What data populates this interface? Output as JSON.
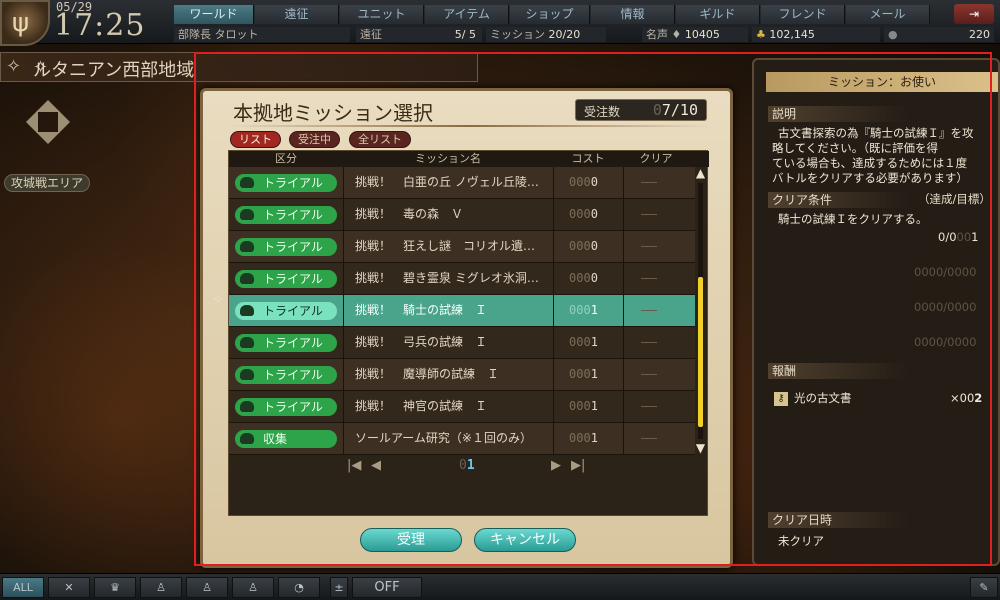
{
  "header": {
    "date": "05/29",
    "time": "17:25",
    "nav": [
      "ワールド",
      "遠征",
      "ユニット",
      "アイテム",
      "ショップ",
      "情報",
      "ギルド",
      "フレンド",
      "メール"
    ],
    "rank": "部隊長 タロット",
    "expedition_label": "遠征",
    "expedition_value": "5/ 5",
    "mission_label": "ミッション",
    "mission_value": "20/20",
    "fame_label": "名声",
    "fame_value": "10405",
    "gold_value": "102,145",
    "crystal_value": "220"
  },
  "region": {
    "title": "ルタニアン西部地域",
    "siege": "攻城戦エリア"
  },
  "panel": {
    "title": "本拠地ミッション選択",
    "count_label": "受注数",
    "count_value": "7/10",
    "filters": [
      "リスト",
      "受注中",
      "全リスト"
    ],
    "columns": [
      "区分",
      "ミッション名",
      "コスト",
      "クリア"
    ],
    "rows": [
      {
        "type": "トライアル",
        "name": "挑戦！　白亜の丘 ノヴェル丘陵…",
        "cost_pad": "000",
        "cost": "0"
      },
      {
        "type": "トライアル",
        "name": "挑戦！　毒の森　Ｖ",
        "cost_pad": "000",
        "cost": "0"
      },
      {
        "type": "トライアル",
        "name": "挑戦！　狂えし謎　コリオル遺…",
        "cost_pad": "000",
        "cost": "0"
      },
      {
        "type": "トライアル",
        "name": "挑戦！　碧き霊泉 ミグレオ氷洞…",
        "cost_pad": "000",
        "cost": "0"
      },
      {
        "type": "トライアル",
        "name": "挑戦！　騎士の試練　Ｉ",
        "cost_pad": "000",
        "cost": "1"
      },
      {
        "type": "トライアル",
        "name": "挑戦！　弓兵の試練　Ｉ",
        "cost_pad": "000",
        "cost": "1"
      },
      {
        "type": "トライアル",
        "name": "挑戦！　魔導師の試練　Ｉ",
        "cost_pad": "000",
        "cost": "1"
      },
      {
        "type": "トライアル",
        "name": "挑戦！　神官の試練　Ｉ",
        "cost_pad": "000",
        "cost": "1"
      },
      {
        "type": "収集",
        "name": "ソールアーム研究（※１回のみ）",
        "cost_pad": "000",
        "cost": "1"
      }
    ],
    "page_pad": "0",
    "page": "1",
    "accept": "受理",
    "cancel": "キャンセル"
  },
  "detail": {
    "title": "ミッション：お使い",
    "desc_label": "説明",
    "desc": [
      "古文書探索の為『騎士の試練Ｉ』を攻",
      "略してください。（既に評価を得",
      "ている場合も、達成するためには１度",
      "バトルをクリアする必要があります）"
    ],
    "cond_label": "クリア条件",
    "cond_sub": "（達成/目標）",
    "cond_text": "騎士の試練Ｉをクリアする。",
    "progress": "0/0",
    "progress_pad": "00",
    "progress_goal": "1",
    "empty1": "0000/0000",
    "empty2": "0000/0000",
    "empty3": "0000/0000",
    "reward_label": "報酬",
    "reward_item": "光の古文書",
    "reward_pad": "×00",
    "reward_qty": "2",
    "date_label": "クリア日時",
    "date_value": "未クリア"
  },
  "footer": {
    "all": "ALL",
    "off": "OFF"
  },
  "colors": {
    "accent": "#4aa48c",
    "badge": "#2ea44a",
    "highlight": "#e02020"
  }
}
